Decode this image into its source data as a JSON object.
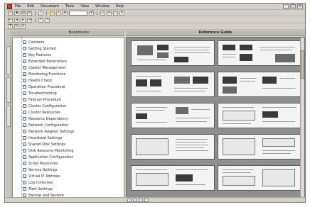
{
  "menubar": {
    "items": [
      "File",
      "Edit",
      "Document",
      "Tools",
      "View",
      "Window",
      "Help"
    ],
    "window_controls": [
      "_",
      "□",
      "×"
    ]
  },
  "toolbar": {
    "zoom_value": "",
    "icons": [
      "open-icon",
      "save-icon",
      "print-icon",
      "email-icon",
      "search-icon",
      "hand-icon",
      "select-icon",
      "zoom-icon",
      "rotate-icon",
      "first-page-icon",
      "prev-page-icon",
      "next-page-icon",
      "last-page-icon"
    ]
  },
  "bookmarks_panel": {
    "header_label": "Bookmarks",
    "items": [
      "Contents",
      "Getting Started",
      "Key Features",
      "Extended Parameters",
      "Cluster Management",
      "Monitoring Functions",
      "Health Check",
      "Operation Procedure",
      "Troubleshooting",
      "Failover Procedure",
      "Cluster Configuration",
      "Cluster Resources",
      "Resource Dependency",
      "Network Configuration",
      "Network Adapter Settings",
      "Heartbeat Settings",
      "Shared Disk Settings",
      "Disk Resource Monitoring",
      "Application Configuration",
      "Script Resources",
      "Service Settings",
      "Virtual IP Address",
      "Log Collection",
      "Alert Settings",
      "Backup and Restore"
    ]
  },
  "document_pane": {
    "title": "Reference Guide"
  },
  "colors": {
    "chrome": "#d4d0c8",
    "page_area": "#8f8f8f",
    "page": "#f4f4f4"
  }
}
